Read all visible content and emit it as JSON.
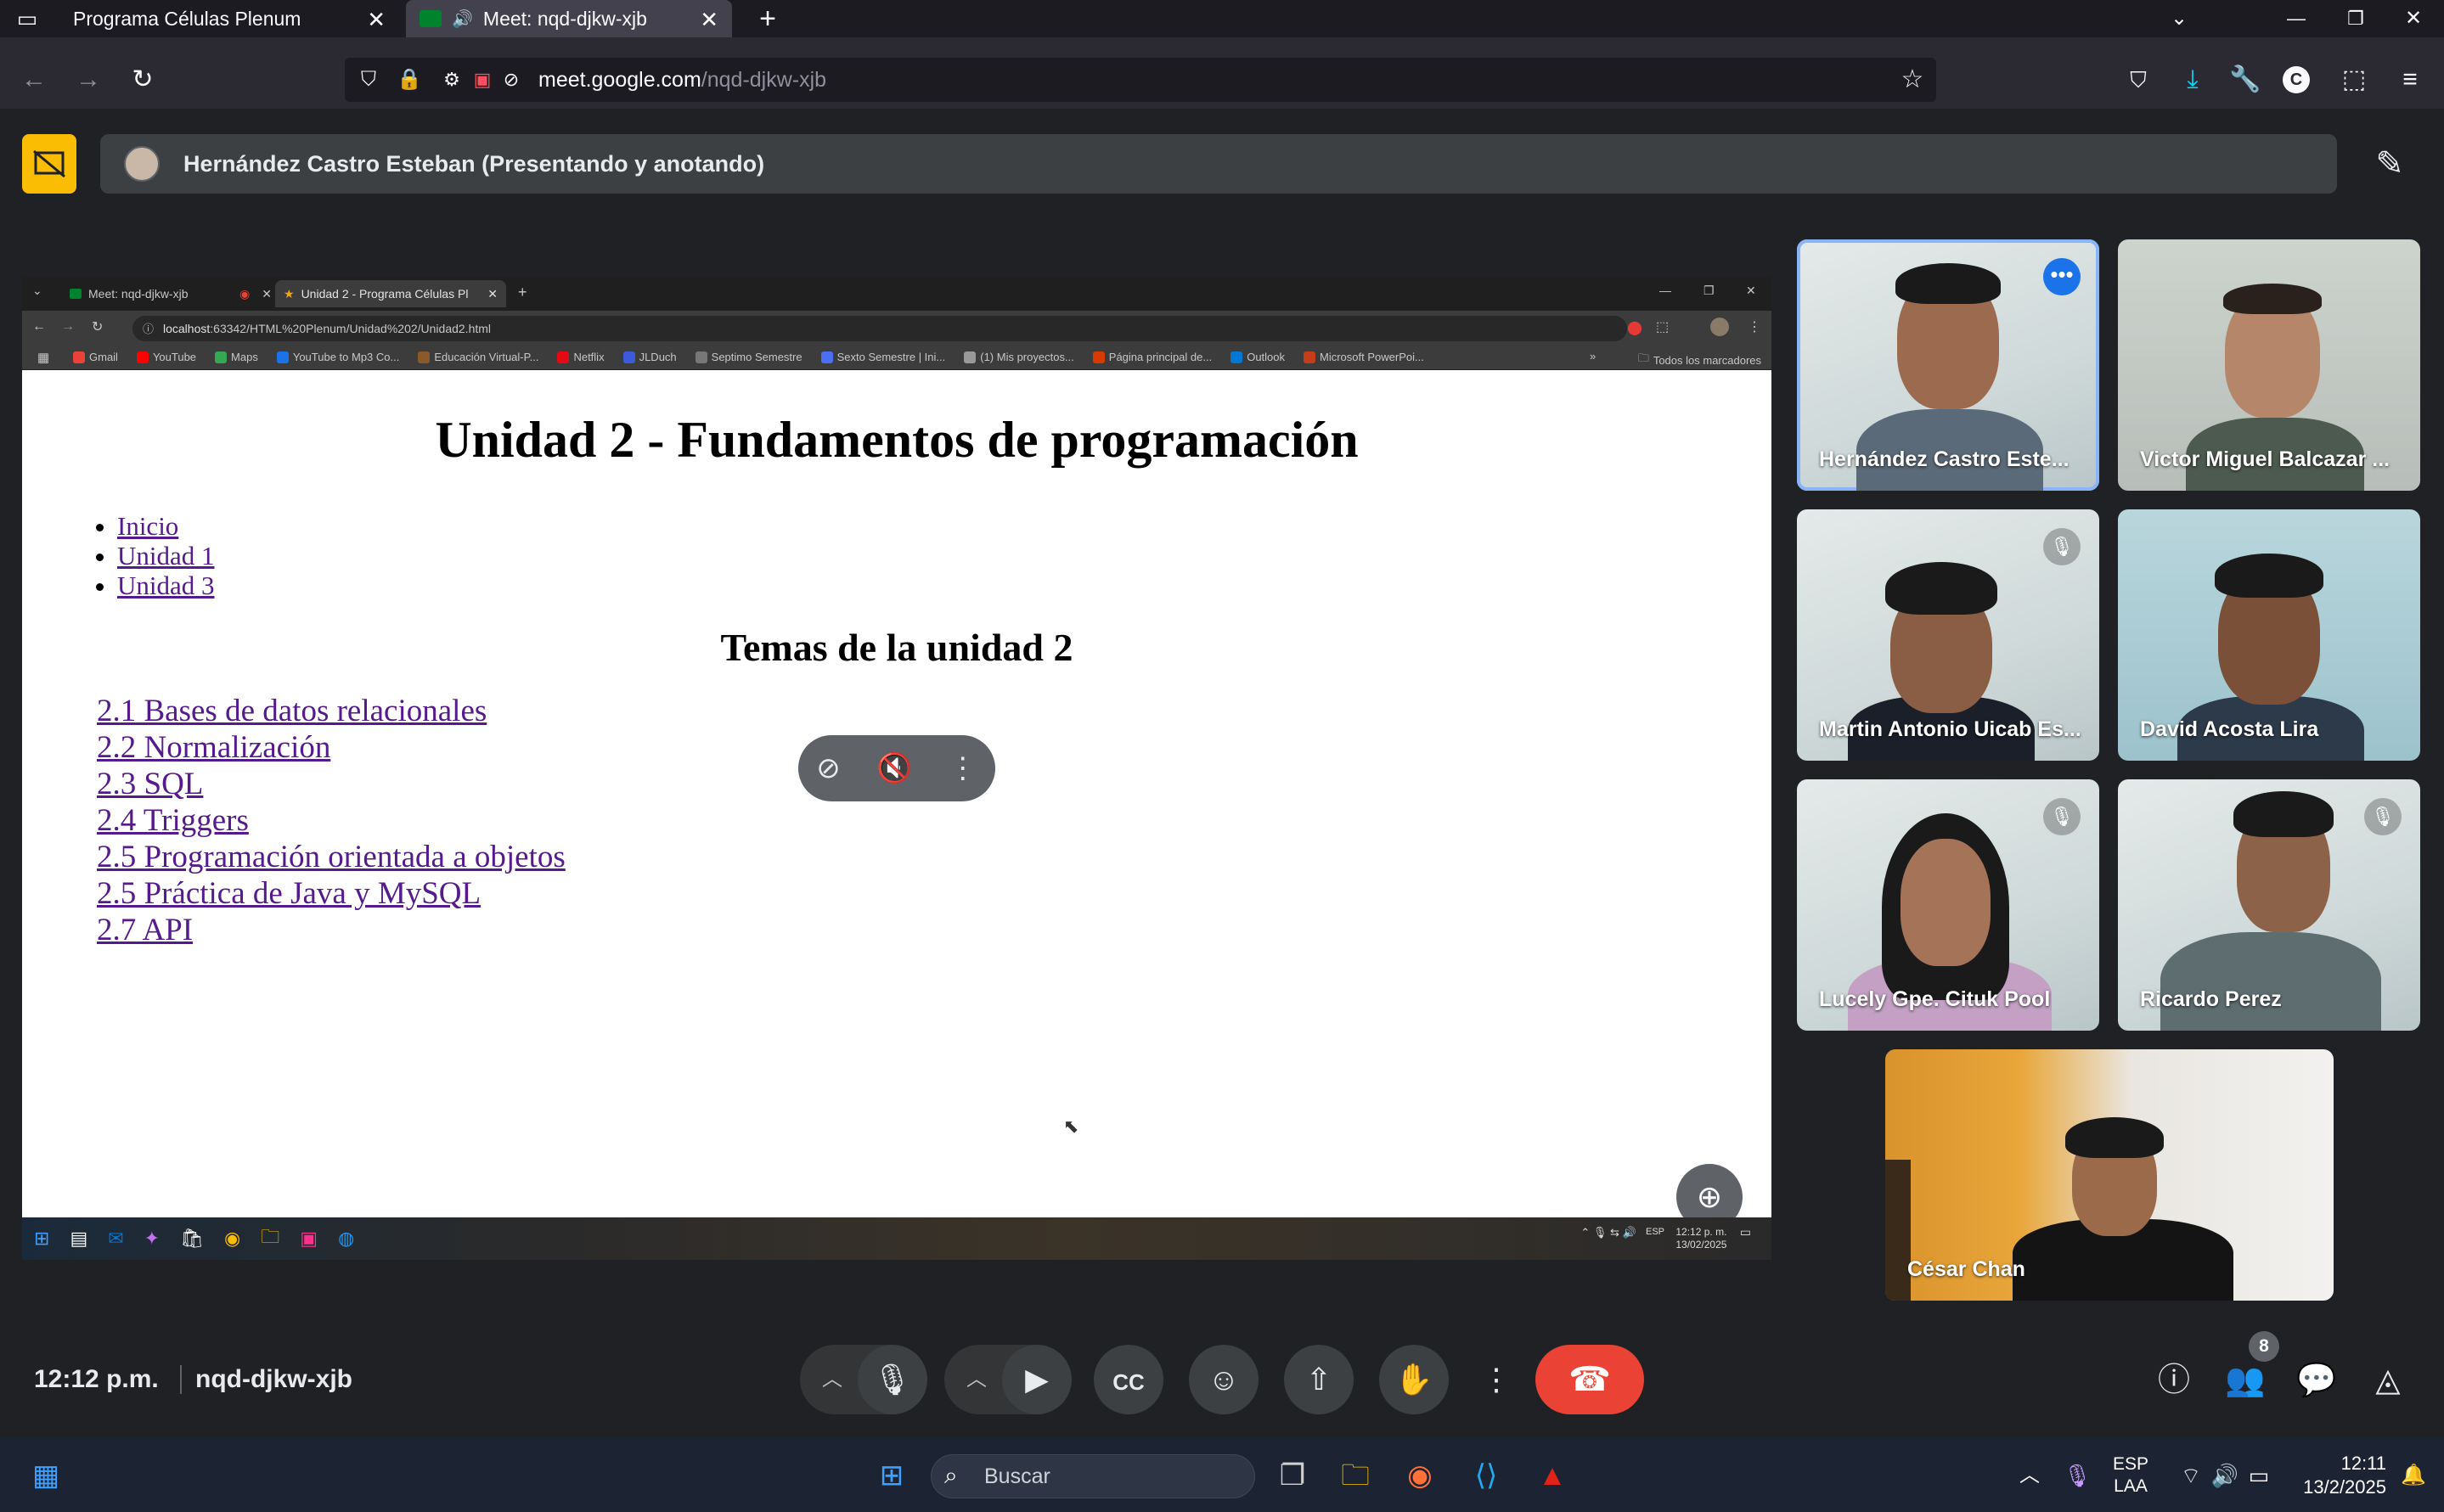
{
  "browser": {
    "tabs": [
      {
        "label": "Programa Células Plenum"
      },
      {
        "label": "Meet: nqd-djkw-xjb"
      }
    ],
    "url": {
      "domain": "meet.google.com",
      "path": "/nqd-djkw-xjb"
    }
  },
  "meet": {
    "presenter_label": "Hernández Castro Esteban (Presentando y anotando)",
    "time": "12:12 p.m.",
    "meeting_code": "nqd-djkw-xjb",
    "participants_count": "8",
    "participants": [
      {
        "name": "Hernández Castro Este...",
        "speaking": true
      },
      {
        "name": "Victor Miguel Balcazar ..."
      },
      {
        "name": "Martin Antonio Uicab Es..."
      },
      {
        "name": "David Acosta Lira"
      },
      {
        "name": "Lucely Gpe. Cituk Pool"
      },
      {
        "name": "Ricardo Perez"
      },
      {
        "name": "César Chan"
      }
    ]
  },
  "shared_screen": {
    "tabs": [
      {
        "label": "Meet: nqd-djkw-xjb"
      },
      {
        "label": "Unidad 2 - Programa Células Pl"
      }
    ],
    "url": {
      "host": "localhost",
      "rest": ":63342/HTML%20Plenum/Unidad%202/Unidad2.html"
    },
    "bookmarks": [
      {
        "label": "Gmail",
        "color": "#ea4335"
      },
      {
        "label": "YouTube",
        "color": "#ff0000"
      },
      {
        "label": "Maps",
        "color": "#34a853"
      },
      {
        "label": "YouTube to Mp3 Co...",
        "color": "#1a73e8"
      },
      {
        "label": "Educación Virtual-P...",
        "color": "#8a5a2b"
      },
      {
        "label": "Netflix",
        "color": "#e50914"
      },
      {
        "label": "JLDuch",
        "color": "#3b5bdb"
      },
      {
        "label": "Septimo Semestre",
        "color": "#777777"
      },
      {
        "label": "Sexto Semestre | Ini...",
        "color": "#4c6ef5"
      },
      {
        "label": "(1) Mis proyectos...",
        "color": "#999999"
      },
      {
        "label": "Página principal de...",
        "color": "#d83b01"
      },
      {
        "label": "Outlook",
        "color": "#0078d4"
      },
      {
        "label": "Microsoft PowerPoi...",
        "color": "#c43e1c"
      }
    ],
    "all_bookmarks": "Todos los marcadores",
    "page": {
      "title": "Unidad 2 - Fundamentos de programación",
      "nav": [
        "Inicio",
        "Unidad 1",
        "Unidad 3"
      ],
      "subtitle": "Temas de la unidad 2",
      "topics": [
        "2.1 Bases de datos relacionales",
        "2.2 Normalización",
        "2.3 SQL",
        "2.4 Triggers",
        "2.5 Programación orientada a objetos",
        "2.5 Práctica de Java y MySQL",
        "2.7 API"
      ]
    },
    "tray": {
      "lang": "ESP",
      "time": "12:12 p. m.",
      "date": "13/02/2025"
    }
  },
  "taskbar": {
    "search_placeholder": "Buscar",
    "lang_top": "ESP",
    "lang_bottom": "LAA",
    "time": "12:11",
    "date": "13/2/2025"
  },
  "colors": {
    "end_call": "#ea4335",
    "present_accent": "#fbbc04",
    "speaking_outline": "#8ab4f8"
  }
}
